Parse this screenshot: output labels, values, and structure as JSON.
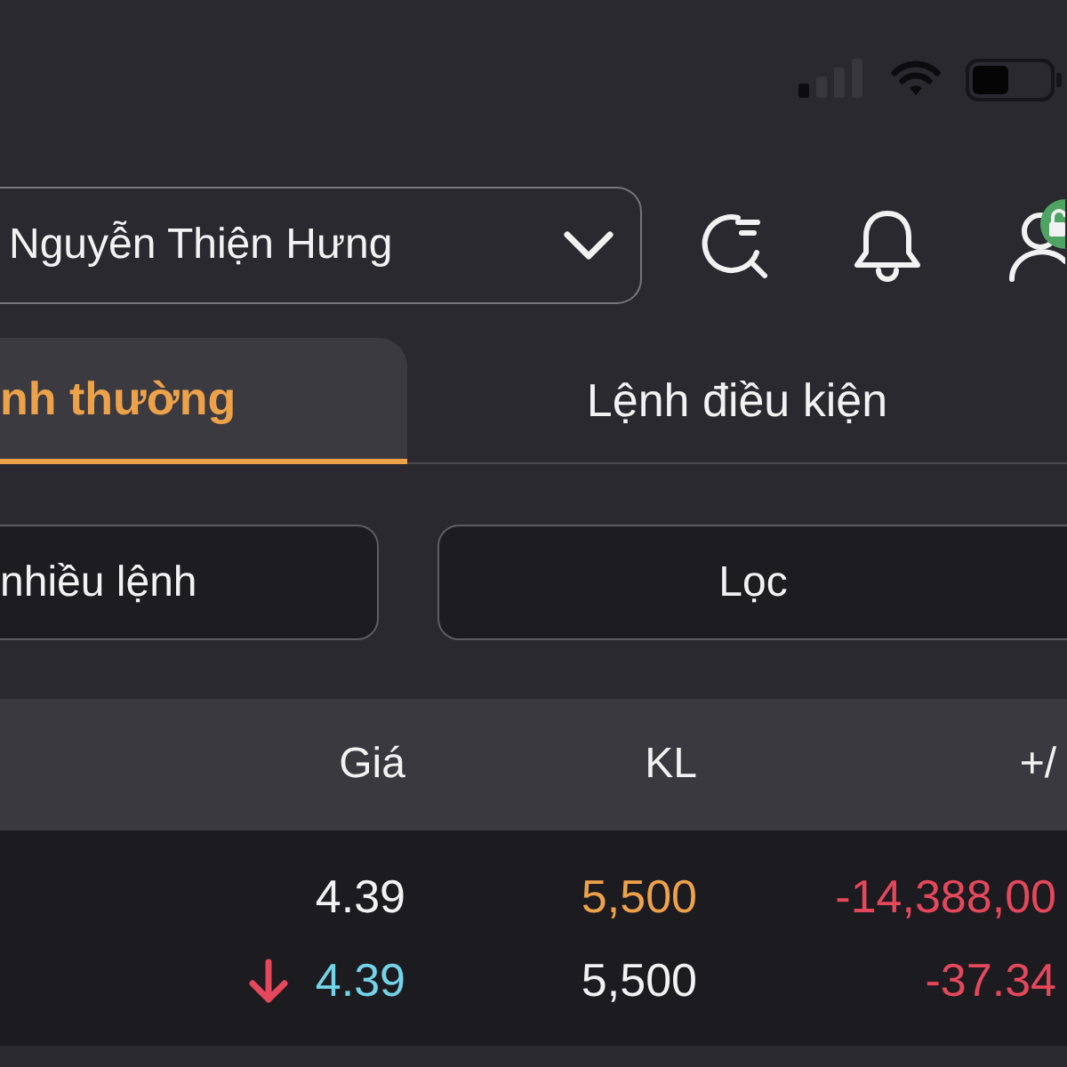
{
  "account_select": {
    "value": "Nguyễn Thiện Hưng"
  },
  "tabs": [
    {
      "label": "nh thường",
      "selected": true
    },
    {
      "label": "Lệnh điều kiện",
      "selected": false
    }
  ],
  "actions": [
    {
      "label": "nhiều lệnh"
    },
    {
      "label": "Lọc"
    }
  ],
  "table": {
    "columns": [
      "Giá",
      "KL",
      "+/"
    ],
    "rows": [
      {
        "cells": [
          {
            "text": "4.39",
            "color": "#f2f2f2"
          },
          {
            "text": "5,500",
            "color": "#eda24a"
          },
          {
            "text": "-14,388,00",
            "color": "#e5475b"
          }
        ]
      },
      {
        "cells": [
          {
            "text": "4.39",
            "color": "#72d4e8",
            "falling": true
          },
          {
            "text": "5,500",
            "color": "#f2f2f2"
          },
          {
            "text": "-37.34",
            "color": "#e5475b"
          }
        ]
      }
    ]
  }
}
